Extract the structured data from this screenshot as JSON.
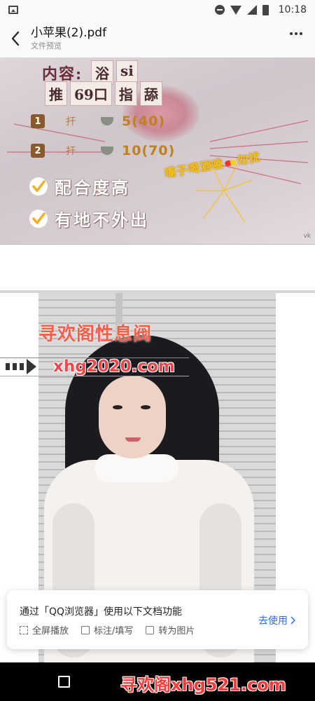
{
  "status_bar": {
    "time": "10:18"
  },
  "header": {
    "title": "小苹果(2).pdf",
    "subtitle": "文件预览"
  },
  "page1": {
    "content_label": "内容:",
    "tags": [
      "浴",
      "si",
      "推",
      "69口",
      "指",
      "舔"
    ],
    "prices": [
      {
        "num": "1",
        "shots": "扞",
        "price": "5(40)"
      },
      {
        "num": "2",
        "shots": "扞",
        "price": "10(70)"
      }
    ],
    "checks": [
      "配合度高",
      "有地不外出"
    ],
    "slogan_a": "嘴子喝酒嗑",
    "slogan_b": "勿扰",
    "corner": "vk"
  },
  "page2": {
    "watermark_title": "寻欢阁性息阀",
    "watermark_url": "xhg2020.com"
  },
  "banner": {
    "title": "通过「QQ浏览器」使用以下文档功能",
    "features": [
      "全屏播放",
      "标注/填写",
      "转为图片"
    ],
    "cta": "去使用"
  },
  "nav_watermark": "寻欢阁xhg521.com"
}
